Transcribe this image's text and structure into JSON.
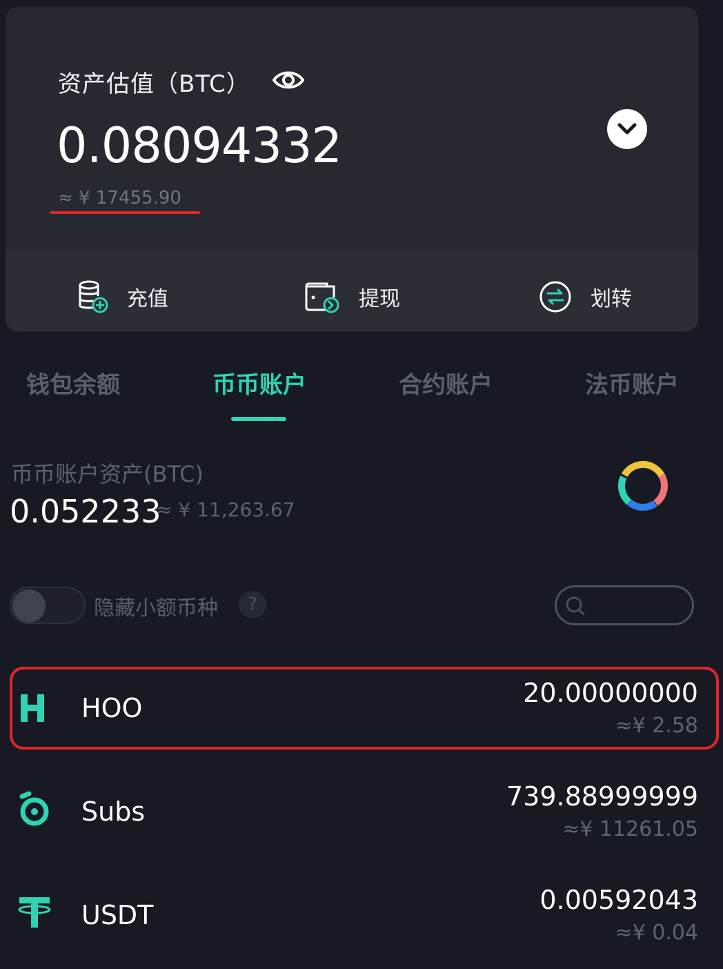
{
  "asset_card": {
    "title": "资产估值（BTC）",
    "value": "0.08094332",
    "fiat": "≈ ¥ 17455.90",
    "actions": [
      {
        "label": "充值",
        "icon": "deposit-icon"
      },
      {
        "label": "提现",
        "icon": "withdraw-icon"
      },
      {
        "label": "划转",
        "icon": "transfer-icon"
      }
    ]
  },
  "tabs": [
    {
      "label": "钱包余额",
      "active": false
    },
    {
      "label": "币币账户",
      "active": true
    },
    {
      "label": "合约账户",
      "active": false
    },
    {
      "label": "法币账户",
      "active": false
    }
  ],
  "account_summary": {
    "label": "币币账户资产(BTC)",
    "value": "0.052233",
    "fiat": "≈ ¥ 11,263.67"
  },
  "filter": {
    "hide_small_label": "隐藏小额币种",
    "hide_small_enabled": false,
    "help_symbol": "?",
    "search_value": ""
  },
  "coins": [
    {
      "name": "HOO",
      "amount": "20.00000000",
      "fiat": "≈¥ 2.58",
      "icon": "hoo-icon"
    },
    {
      "name": "Subs",
      "amount": "739.88999999",
      "fiat": "≈¥ 11261.05",
      "icon": "subs-icon"
    },
    {
      "name": "USDT",
      "amount": "0.00592043",
      "fiat": "≈¥ 0.04",
      "icon": "usdt-icon"
    }
  ],
  "colors": {
    "accent": "#2fd3b5",
    "highlight": "#e0262c",
    "background": "#171a22",
    "card": "#262930"
  }
}
